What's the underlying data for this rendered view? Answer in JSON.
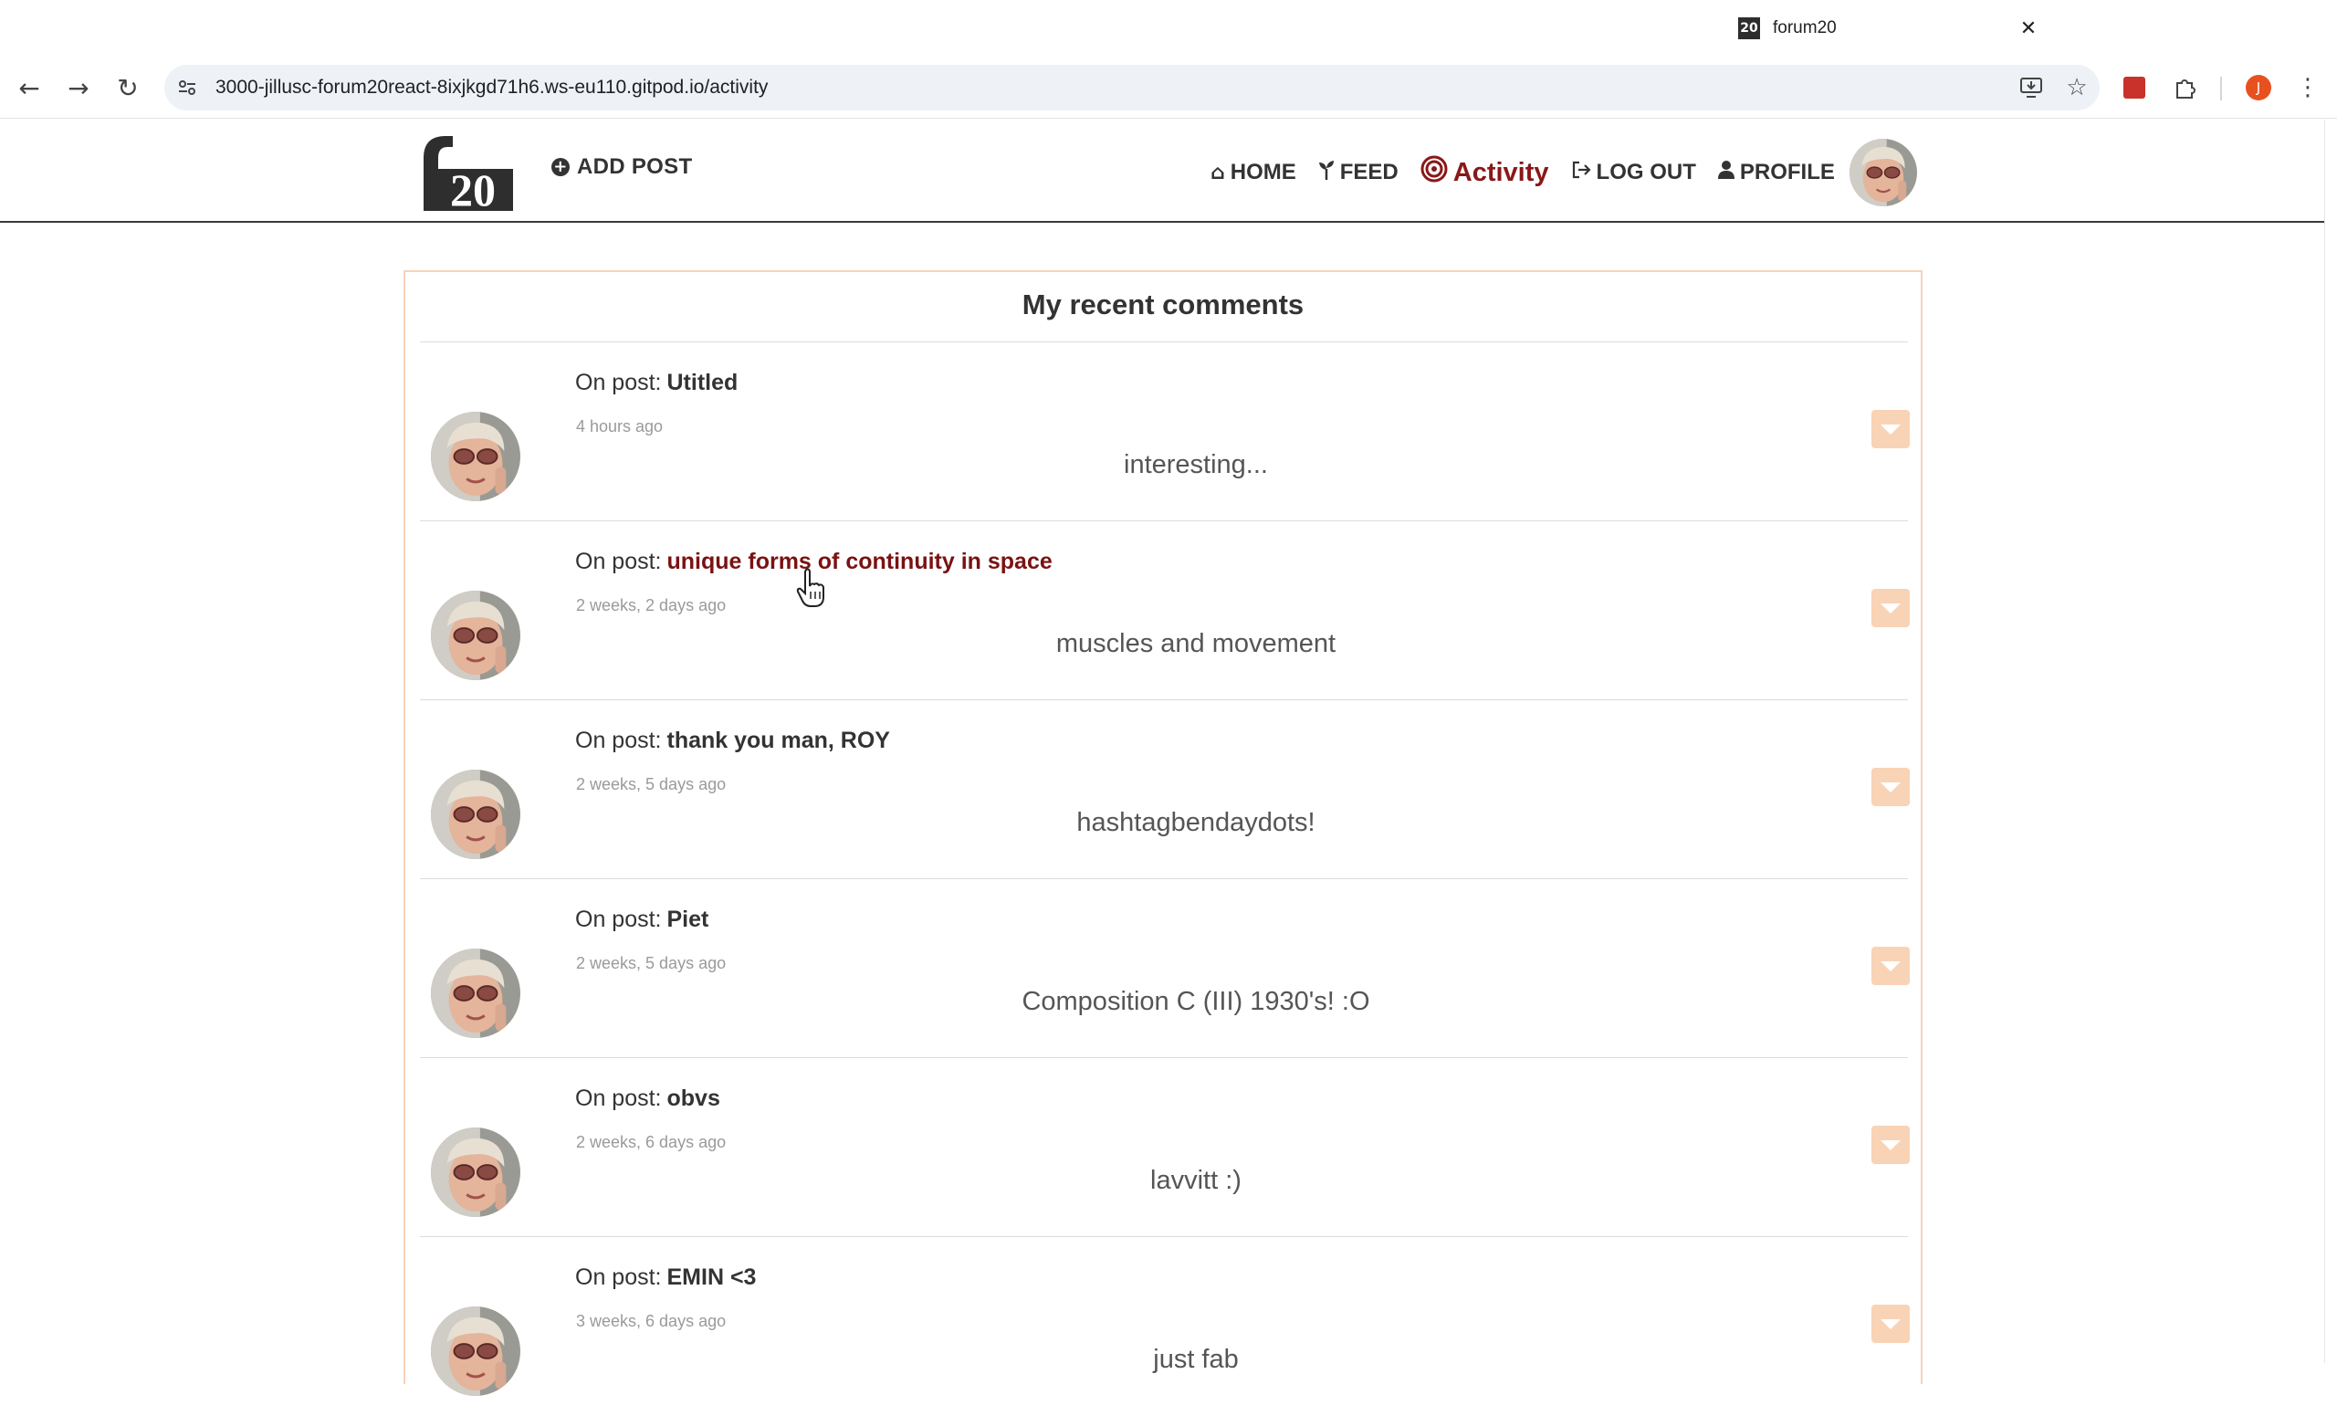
{
  "browser": {
    "tab_title": "forum20",
    "tab_favicon_text": "20",
    "url": "3000-jillusc-forum20react-8ixjkgd71h6.ws-eu110.gitpod.io/activity",
    "profile_initial": "J"
  },
  "header": {
    "logo_alt": "f20",
    "add_post_label": "ADD POST",
    "nav": [
      {
        "label": "HOME",
        "icon": "home-icon"
      },
      {
        "label": "FEED",
        "icon": "sprout-icon"
      },
      {
        "label": "Activity",
        "icon": "target-icon",
        "active": true
      },
      {
        "label": "LOG OUT",
        "icon": "logout-icon"
      },
      {
        "label": "PROFILE",
        "icon": "user-icon"
      }
    ]
  },
  "main": {
    "title": "My recent comments",
    "on_post_label": "On post:",
    "comments": [
      {
        "post": "Utitled",
        "time": "4 hours ago",
        "text": "interesting..."
      },
      {
        "post": "unique forms of continuity in space",
        "time": "2 weeks, 2 days ago",
        "text": "muscles and movement",
        "hover": true
      },
      {
        "post": "thank you man, ROY",
        "time": "2 weeks, 5 days ago",
        "text": "hashtagbendaydots!"
      },
      {
        "post": "Piet",
        "time": "2 weeks, 5 days ago",
        "text": "Composition C (III) 1930's! :O"
      },
      {
        "post": "obvs",
        "time": "2 weeks, 6 days ago",
        "text": "lavvitt :)"
      },
      {
        "post": "EMIN <3",
        "time": "3 weeks, 6 days ago",
        "text": "just fab"
      }
    ]
  },
  "colors": {
    "accent": "#8a1818",
    "card_border": "#f8d3b8",
    "menu_button": "#f9d3b6"
  }
}
